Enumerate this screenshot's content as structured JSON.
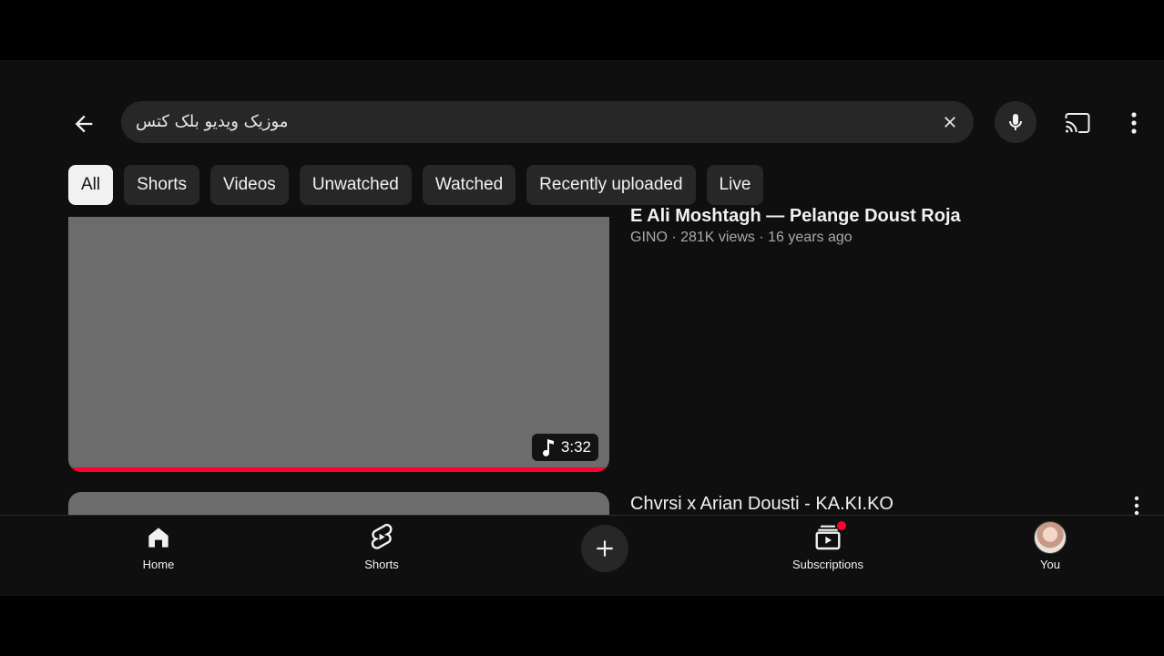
{
  "header": {
    "search_value": "موزیک ویدیو بلک کتس"
  },
  "chips": [
    {
      "label": "All",
      "active": true
    },
    {
      "label": "Shorts"
    },
    {
      "label": "Videos"
    },
    {
      "label": "Unwatched"
    },
    {
      "label": "Watched"
    },
    {
      "label": "Recently uploaded"
    },
    {
      "label": "Live"
    }
  ],
  "results": [
    {
      "title_partial": "E Ali Moshtagh — Pelange Doust Roja",
      "meta": "GINO · 281K views · 16 years ago",
      "duration": "3:32",
      "watched_fraction": 1.0
    },
    {
      "title": "Chvrsi x Arian Dousti - KA.KI.KO"
    }
  ],
  "bottom_nav": {
    "home": "Home",
    "shorts": "Shorts",
    "subscriptions": "Subscriptions",
    "you": "You"
  },
  "colors": {
    "background": "#0f0f0f",
    "chip": "#272727",
    "accent": "#ff0033"
  }
}
